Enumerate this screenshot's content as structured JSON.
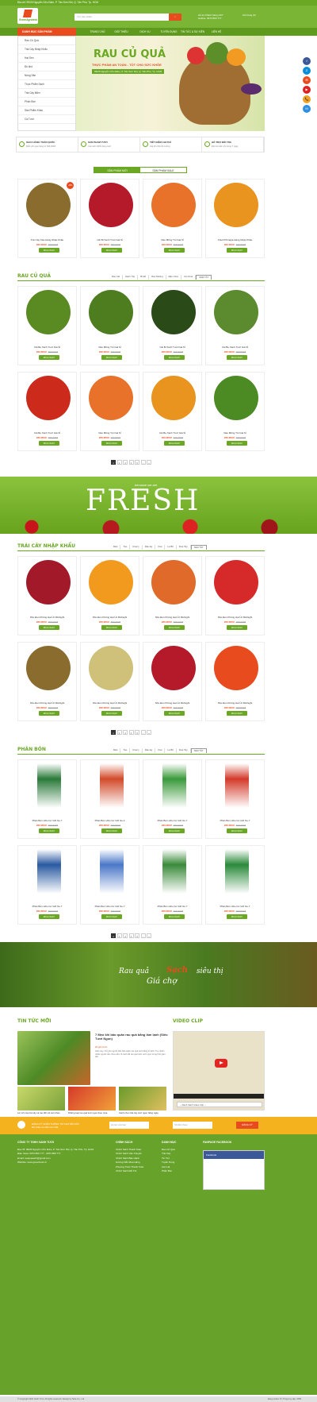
{
  "topbar": {
    "address": "Địa chỉ: 99/26 Nguyễn Cửu Đàm, P. Tân Sơn Nhì, Q. Tân Phú, Tp. HCM"
  },
  "header": {
    "logo_text": "GreenAgrotech",
    "search_placeholder": "Tìm sản phẩm",
    "hotline_label": "Hỗ trợ khách hàng 24/7",
    "hotline": "Hotline: 0973 860 777",
    "account": "Giỏ hàng (0)"
  },
  "nav": {
    "category_button": "DANH MỤC SẢN PHẨM",
    "items": [
      "TRANG CHỦ",
      "GIỚI THIỆU",
      "DỊCH VỤ",
      "TUYỂN DỤNG",
      "TIN TỨC & SỰ KIỆN",
      "LIÊN HỆ"
    ]
  },
  "sidebar_categories": [
    "Rau Củ Quả",
    "Trái Cây Nhập Khẩu",
    "Hạt Sen",
    "Đồ khô",
    "Nông Sản",
    "Thực Phẩm Sạch",
    "Trái Cây Miền",
    "Phân Bón",
    "Sản Phẩm Khác",
    "Cá Tươi"
  ],
  "banner": {
    "title": "RAU CỦ QUẢ",
    "subtitle": "THỰC PHẨM AN TOÀN - TỐT CHO SỨC KHỎE",
    "address": "99/26 Nguyễn Cửu Đàm, P. Tân Sơn Nhì, Q. Tân Phú, Tp. HCM"
  },
  "usp": [
    {
      "title": "GIAO HÀNG TOÀN QUỐC",
      "desc": "Miễn phí giao hàng từ 500.000đ"
    },
    {
      "title": "SẢN PHẨM TƯƠI",
      "desc": "Cam kết 100% hàng tươi"
    },
    {
      "title": "TIẾT KIỆM CHI PHÍ",
      "desc": "Giá tốt nhất thị trường"
    },
    {
      "title": "HỖ TRỢ ĐỔI TRẢ",
      "desc": "Đổi trả miễn phí trong 7 ngày"
    }
  ],
  "tabs": {
    "new": "SẢN PHẨM MỚI",
    "sale": "SẢN PHẨM SALE"
  },
  "common": {
    "price": "220.000đ",
    "old_price": "300.000đ",
    "buy": "MUA NGAY",
    "sale_badge": "-30%",
    "view_all": "XEM TẤT"
  },
  "new_products": [
    {
      "name": "Trái Cây Kiwi Hàng Nhập Khẩu"
    },
    {
      "name": "Cốt Bi Xanh Tươi Giá Sỉ"
    },
    {
      "name": "Rau Mồng Tơi Giá Sỉ"
    },
    {
      "name": "Chuối Phinapa Hàng Nhập Khẩu"
    }
  ],
  "rau_cu_qua": {
    "title": "RAU CỦ QUẢ",
    "filters": [
      "Rau Cải",
      "Hành Tây",
      "Bí Đỏ",
      "Rau Muống",
      "Đậu Côve",
      "Cà Chua"
    ],
    "products": [
      {
        "name": "Cải Bẹ Xanh Tươi Giá Sỉ"
      },
      {
        "name": "Rau Mồng Tơi Giá Sỉ"
      },
      {
        "name": "Cải Bi Xanh Tươi Giá Sỉ"
      },
      {
        "name": "Cải Bẹ Xanh Tươi Giá Sỉ"
      },
      {
        "name": "Cải Bẹ Xanh Tươi Giá Sỉ"
      },
      {
        "name": "Rau Mồng Tơi Giá Sỉ"
      },
      {
        "name": "Cải Bẹ Xanh Tươi Giá Sỉ"
      },
      {
        "name": "Rau Mồng Tơi Giá Sỉ"
      }
    ]
  },
  "pager": [
    "1",
    "2",
    "3",
    "4",
    "5",
    "›",
    "»"
  ],
  "fresh": {
    "small": "because we are",
    "big": "FRESH"
  },
  "trai_cay": {
    "title": "TRÁI CÂY NHẬP KHẨU",
    "filters": [
      "Mận",
      "Táo",
      "Cherry",
      "Dâu tây",
      "Kiwi",
      "Lê Bồ",
      "Dưa Tây"
    ],
    "products": [
      {
        "name": "Nho Đen Không Hạt Úc Midnight"
      },
      {
        "name": "Nho Đen Không Hạt Úc Midnight"
      },
      {
        "name": "Nho Đen Không Hạt Úc Midnight"
      },
      {
        "name": "Nho Đen Không Hạt Úc Midnight"
      },
      {
        "name": "Nho Đen Không Hạt Úc Midnight"
      },
      {
        "name": "Nho Đen Không Hạt Úc Midnight"
      },
      {
        "name": "Nho Đen Không Hạt Úc Midnight"
      },
      {
        "name": "Nho Đen Không Hạt Úc Midnight"
      }
    ]
  },
  "phan_bon": {
    "title": "PHÂN BÓN",
    "filters": [
      "Mận",
      "Táo",
      "Cherry",
      "Dâu tây",
      "Kiwi",
      "Lê Bồ",
      "Dưa Tây"
    ],
    "products": [
      {
        "name": "Phân Bón Hữu Cơ GFI No.7"
      },
      {
        "name": "Phân Bón Hữu Cơ GFI No.2"
      },
      {
        "name": "Phân Bón Hữu Cơ GFI No.7"
      },
      {
        "name": "Phân Bón Hữu Cơ GFI No.7"
      },
      {
        "name": "Phân Bón Hữu Cơ GFI No.7"
      },
      {
        "name": "Phân Bón Hữu Cơ GFI No.7"
      },
      {
        "name": "Phân Bón Hữu Cơ GFI No.7"
      },
      {
        "name": "Phân Bón Hữu Cơ GFI No.7"
      }
    ]
  },
  "slogan": {
    "a": "Rau quả",
    "b": "Sạch",
    "c": "siêu thị",
    "d": "Giá chợ"
  },
  "news": {
    "title": "TIN TỨC MỚI",
    "lead_title": "7 Mẹo khi bảo quản rau quả bằng làm lạnh (Siêu Tươi Ngon)",
    "lead_date": "20 giờ trước",
    "lead_desc": "Hiện nay, chủ yếu người dân bảo quản rau quả tươi bằng tủ lạnh. Tuy nhiên nhiều người vẫn chưa nắm rõ cách để rau quả luôn tươi ngon trong thời gian dài.",
    "small": [
      {
        "caption": "Lợi ích của trái cây và rau đối với sức khỏe"
      },
      {
        "caption": "Những loại rau quả tươi ngon theo mùa"
      },
      {
        "caption": "Cách chọn trái cây tươi ngon hằng ngày"
      }
    ]
  },
  "video": {
    "title": "VIDEO CLIP",
    "select": "-- Danh Sách Video Clip --"
  },
  "subscribe": {
    "line1": "ĐĂNG KÝ NHẬN THÔNG TIN KHUYẾN MÃI",
    "line2": "Để nhận ưu đãi mới nhất",
    "name_placeholder": "Họ tên của bạn",
    "phone_placeholder": "Số điện thoại",
    "button": "ĐĂNG KÝ"
  },
  "footer": {
    "company": "CÔNG TY TNHH XANH TƯƠI",
    "address": "Địa chỉ: 99/26 Nguyễn Cửu Đàm, P. Tân Sơn Nhì, Q. Tân Phú, Tp. HCM",
    "phone": "Điện thoại: 0973 860 777 - 0973 860 777",
    "email": "Email: rauquasach@gmail.com",
    "web": "Website: www.greenfood.vn",
    "col2_title": "CHÍNH SÁCH",
    "col2": [
      "Chính Sách Thanh Toán",
      "Chính Sách Vận Chuyển",
      "Chính Sách Bảo Hành",
      "Hướng Dẫn Mua Hàng",
      "Phương Thức Thanh Toán",
      "Chính Sách Đổi Trả"
    ],
    "col3_title": "DANH MỤC",
    "col3": [
      "Rau Củ Quả",
      "Trái Cây",
      "Tin Tức",
      "Tuyển Dụng",
      "Liên Hệ",
      "Phân Bón"
    ],
    "col4_title": "FANPAGE FACEBOOK",
    "fb_name": "Facebook"
  },
  "copyright": "© Copyright 2021 Xanh Tươi. All rights reserved. Design by Nina Co., Ltd",
  "online": "Đang online: 8  |  Tổng truy cập: 4789",
  "social": [
    "f",
    "Z",
    "✉",
    "▶",
    "📞",
    "M"
  ],
  "colors": {
    "green": "#6aa823",
    "orange": "#e84c1e"
  }
}
